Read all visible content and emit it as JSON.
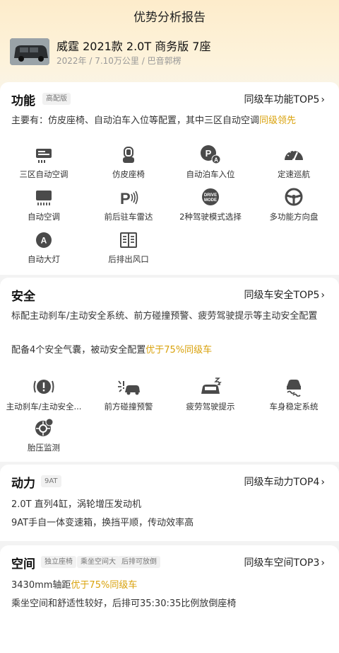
{
  "header": {
    "title": "优势分析报告",
    "car_name": "威霆 2021款 2.0T 商务版 7座",
    "car_sub": "2022年 / 7.10万公里 / 巴音郭楞"
  },
  "sections": {
    "function": {
      "title": "功能",
      "tag": "高配版",
      "rank": "同级车功能TOP5",
      "desc_prefix": "主要有：仿皮座椅、自动泊车入位等配置，其中三区自动空调",
      "desc_highlight": "同级领先",
      "features": [
        {
          "label": "三区自动空调",
          "icon": "ac-icon"
        },
        {
          "label": "仿皮座椅",
          "icon": "seat-icon"
        },
        {
          "label": "自动泊车入位",
          "icon": "auto-park-icon"
        },
        {
          "label": "定速巡航",
          "icon": "cruise-icon"
        },
        {
          "label": "自动空调",
          "icon": "auto-ac-icon"
        },
        {
          "label": "前后驻车雷达",
          "icon": "parking-radar-icon"
        },
        {
          "label": "2种驾驶模式选择",
          "icon": "drive-mode-icon"
        },
        {
          "label": "多功能方向盘",
          "icon": "steering-wheel-icon"
        },
        {
          "label": "自动大灯",
          "icon": "auto-headlight-icon"
        },
        {
          "label": "后排出风口",
          "icon": "rear-vent-icon"
        }
      ],
      "drive_mode_text_1": "DRIVE",
      "drive_mode_text_2": "MODE",
      "auto_park_letter": "P",
      "auto_park_sub": "A",
      "radar_letter": "P",
      "headlight_letter": "A"
    },
    "safety": {
      "title": "安全",
      "rank": "同级车安全TOP5",
      "desc1": "标配主动刹车/主动安全系统、前方碰撞预警、疲劳驾驶提示等主动安全配置",
      "desc2_prefix": "配备4个安全气囊，被动安全配置",
      "desc2_highlight": "优于75%同级车",
      "features": [
        {
          "label": "主动刹车/主动安全...",
          "icon": "active-brake-icon"
        },
        {
          "label": "前方碰撞预警",
          "icon": "collision-warning-icon"
        },
        {
          "label": "疲劳驾驶提示",
          "icon": "fatigue-icon"
        },
        {
          "label": "车身稳定系统",
          "icon": "stability-icon"
        },
        {
          "label": "胎压监测",
          "icon": "tire-pressure-icon"
        }
      ]
    },
    "power": {
      "title": "动力",
      "tag": "9AT",
      "rank": "同级车动力TOP4",
      "line1": "2.0T 直列4缸，涡轮增压发动机",
      "line2": "9AT手自一体变速箱，换挡平顺，传动效率高"
    },
    "space": {
      "title": "空间",
      "tags": [
        "独立座椅",
        "乘坐空间大",
        "后排可放倒"
      ],
      "rank": "同级车空间TOP3",
      "line1_prefix": "3430mm轴距",
      "line1_highlight": "优于75%同级车",
      "line2": "乘坐空间和舒适性较好，后排可35:30:35比例放倒座椅"
    }
  },
  "colors": {
    "accent": "#d9a20c",
    "icon": "#4a4a4a"
  }
}
